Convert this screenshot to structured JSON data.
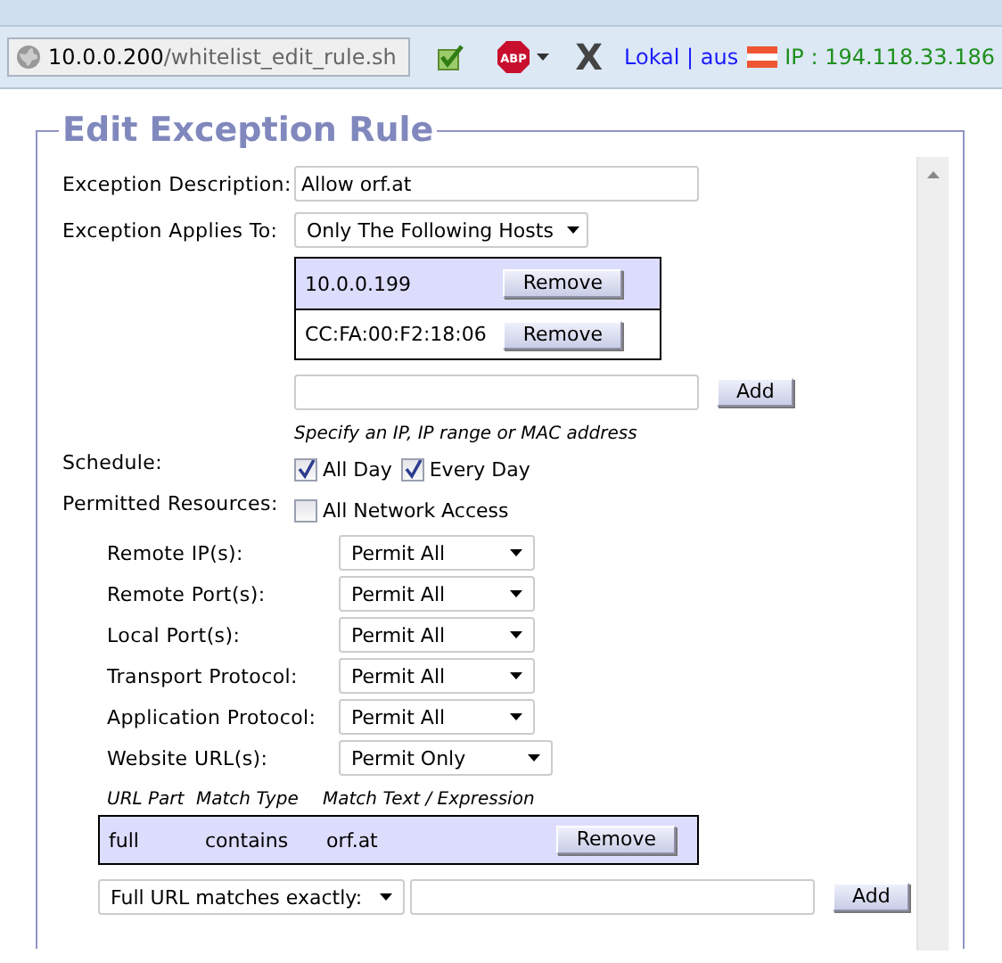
{
  "toolbar": {
    "url_host": "10.0.0.200",
    "url_path": "/whitelist_edit_rule.sh",
    "status_text": "Lokal | aus",
    "ip_text": "IP : 194.118.33.186",
    "close_glyph": "X",
    "adblock_label": "ABP"
  },
  "panel": {
    "title": "Edit Exception Rule",
    "description": {
      "label": "Exception Description:",
      "value": "Allow orf.at"
    },
    "applies_to": {
      "label": "Exception Applies To:",
      "value": "Only The Following Hosts"
    },
    "hosts": [
      {
        "address": "10.0.0.199",
        "button": "Remove"
      },
      {
        "address": "CC:FA:00:F2:18:06",
        "button": "Remove"
      }
    ],
    "host_add": {
      "button": "Add",
      "hint": "Specify an IP, IP range or MAC address"
    },
    "schedule": {
      "label": "Schedule:",
      "options": [
        {
          "label": "All Day",
          "checked": true
        },
        {
          "label": "Every Day",
          "checked": true
        }
      ]
    },
    "resources": {
      "label": "Permitted Resources:",
      "option": {
        "label": "All Network Access",
        "checked": false
      }
    },
    "resource_rows": [
      {
        "label": "Remote IP(s):",
        "value": "Permit All"
      },
      {
        "label": "Remote Port(s):",
        "value": "Permit All"
      },
      {
        "label": "Local Port(s):",
        "value": "Permit All"
      },
      {
        "label": "Transport Protocol:",
        "value": "Permit All"
      },
      {
        "label": "Application Protocol:",
        "value": "Permit All"
      },
      {
        "label": "Website URL(s):",
        "value": "Permit Only"
      }
    ],
    "url_table": {
      "columns": [
        "URL Part",
        "Match Type",
        "Match Text / Expression"
      ],
      "rows": [
        {
          "cells": [
            "full",
            "contains",
            "orf.at"
          ],
          "button": "Remove"
        }
      ]
    },
    "url_add": {
      "select": "Full URL matches exactly:",
      "button": "Add"
    }
  }
}
